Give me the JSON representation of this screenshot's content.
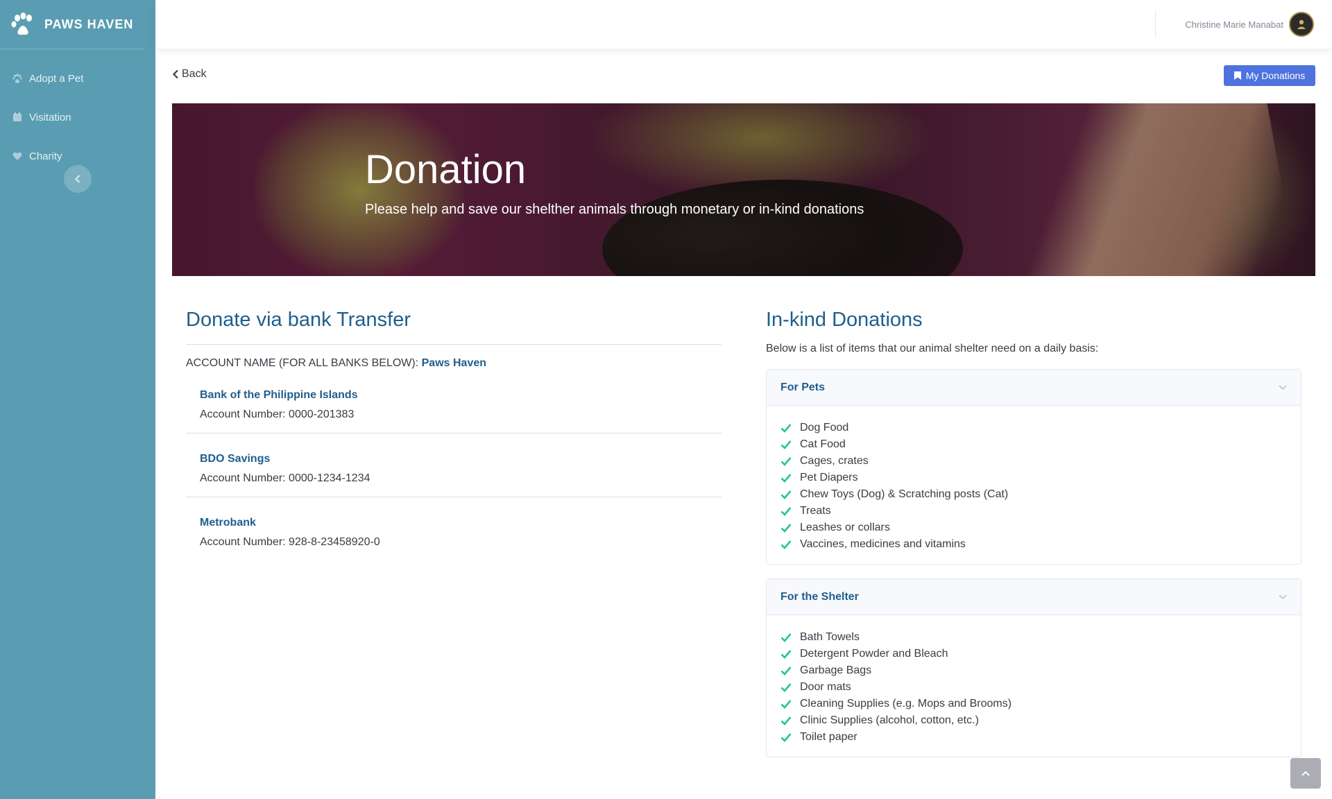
{
  "brand": {
    "name": "PAWS HAVEN",
    "icon": "paw-icon"
  },
  "sidebar": {
    "items": [
      {
        "label": "Adopt a Pet",
        "icon": "paw-icon"
      },
      {
        "label": "Visitation",
        "icon": "calendar-icon"
      },
      {
        "label": "Charity",
        "icon": "heart-icon"
      }
    ],
    "toggle_icon": "chevron-left-icon"
  },
  "topbar": {
    "user_name": "Christine Marie Manabat"
  },
  "actions": {
    "back_label": "Back",
    "my_donations_label": "My Donations"
  },
  "hero": {
    "title": "Donation",
    "subtitle": "Please help and save our shelther animals through monetary or in-kind donations"
  },
  "bank_transfer": {
    "title": "Donate via bank Transfer",
    "account_name_label": "ACCOUNT NAME (FOR ALL BANKS BELOW):",
    "account_name": "Paws Haven",
    "banks": [
      {
        "name": "Bank of the Philippine Islands",
        "account": "Account Number: 0000-201383"
      },
      {
        "name": "BDO Savings",
        "account": "Account Number: 0000-1234-1234"
      },
      {
        "name": "Metrobank",
        "account": "Account Number: 928-8-23458920-0"
      }
    ]
  },
  "in_kind": {
    "title": "In-kind Donations",
    "intro": "Below is a list of items that our animal shelter need on a daily basis:",
    "groups": [
      {
        "title": "For Pets",
        "items": [
          "Dog Food",
          "Cat Food",
          "Cages, crates",
          "Pet Diapers",
          "Chew Toys (Dog) & Scratching posts (Cat)",
          "Treats",
          "Leashes or collars",
          "Vaccines, medicines and vitamins"
        ]
      },
      {
        "title": "For the Shelter",
        "items": [
          "Bath Towels",
          "Detergent Powder and Bleach",
          "Garbage Bags",
          "Door mats",
          "Cleaning Supplies (e.g. Mops and Brooms)",
          "Clinic Supplies (alcohol, cotton, etc.)",
          "Toilet paper"
        ]
      }
    ]
  },
  "colors": {
    "sidebar": "#5a9db2",
    "accent": "#4e73df",
    "heading": "#1f5e8c",
    "check": "#1cc88a"
  }
}
